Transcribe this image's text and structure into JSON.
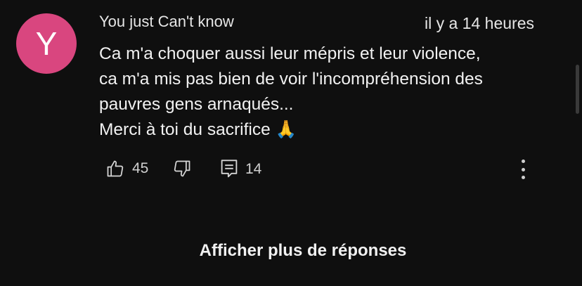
{
  "comment": {
    "avatar_letter": "Y",
    "avatar_color": "#d9467f",
    "author": "You just Can't know",
    "timestamp": "il y a 14 heures",
    "lines": [
      "Ca m'a choquer aussi leur mépris et leur violence,",
      "ca m'a mis pas bien de voir l'incompréhension des",
      "pauvres gens arnaqués...",
      "Merci à toi du sacrifice 🙏"
    ]
  },
  "actions": {
    "like_icon": "thumbs-up-icon",
    "like_count": "45",
    "dislike_icon": "thumbs-down-icon",
    "reply_icon": "reply-comment-icon",
    "reply_count": "14",
    "more_icon": "more-vertical-icon"
  },
  "footer": {
    "show_more_label": "Afficher plus de réponses"
  }
}
